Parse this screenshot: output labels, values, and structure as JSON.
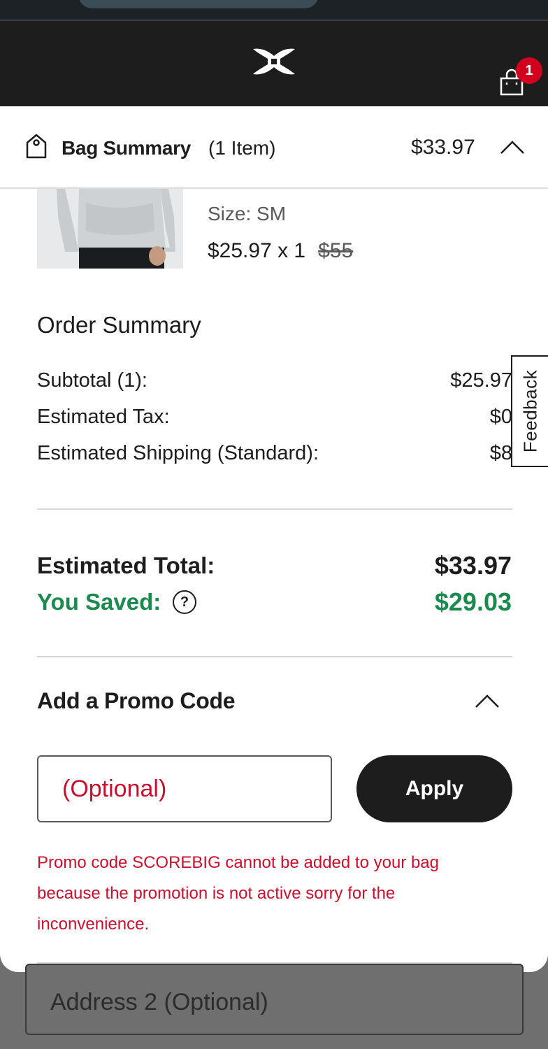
{
  "header": {
    "logo_icon": "under-armour-logo",
    "bag_icon": "shopping-bag-icon",
    "bag_count": "1"
  },
  "bag_summary": {
    "icon": "tag-icon",
    "title": "Bag Summary",
    "count": "(1 Item)",
    "price": "$33.97",
    "toggle_icon": "chevron-up-icon"
  },
  "product": {
    "size": "Size: SM",
    "price": "$25.97 x 1",
    "original_price": "$55"
  },
  "order_summary": {
    "title": "Order Summary",
    "rows": [
      {
        "label": "Subtotal (1):",
        "value": "$25.97"
      },
      {
        "label": "Estimated Tax:",
        "value": "$0"
      },
      {
        "label": "Estimated Shipping (Standard):",
        "value": "$8"
      }
    ],
    "total_label": "Estimated Total:",
    "total_value": "$33.97",
    "saved_label": "You Saved:",
    "saved_value": "$29.03",
    "help_icon": "?"
  },
  "feedback": {
    "label": "Feedback"
  },
  "promo": {
    "title": "Add a Promo Code",
    "placeholder": "(Optional)",
    "apply_label": "Apply",
    "error": "Promo code SCOREBIG cannot be added to your bag because the promotion is not active sorry for the inconvenience."
  },
  "background_form": {
    "address2_placeholder": "Address 2 (Optional)"
  },
  "colors": {
    "header_bg": "#1d1d1d",
    "badge": "#d1001f",
    "saved_green": "#1b8a4f",
    "error_red": "#c8102e"
  }
}
